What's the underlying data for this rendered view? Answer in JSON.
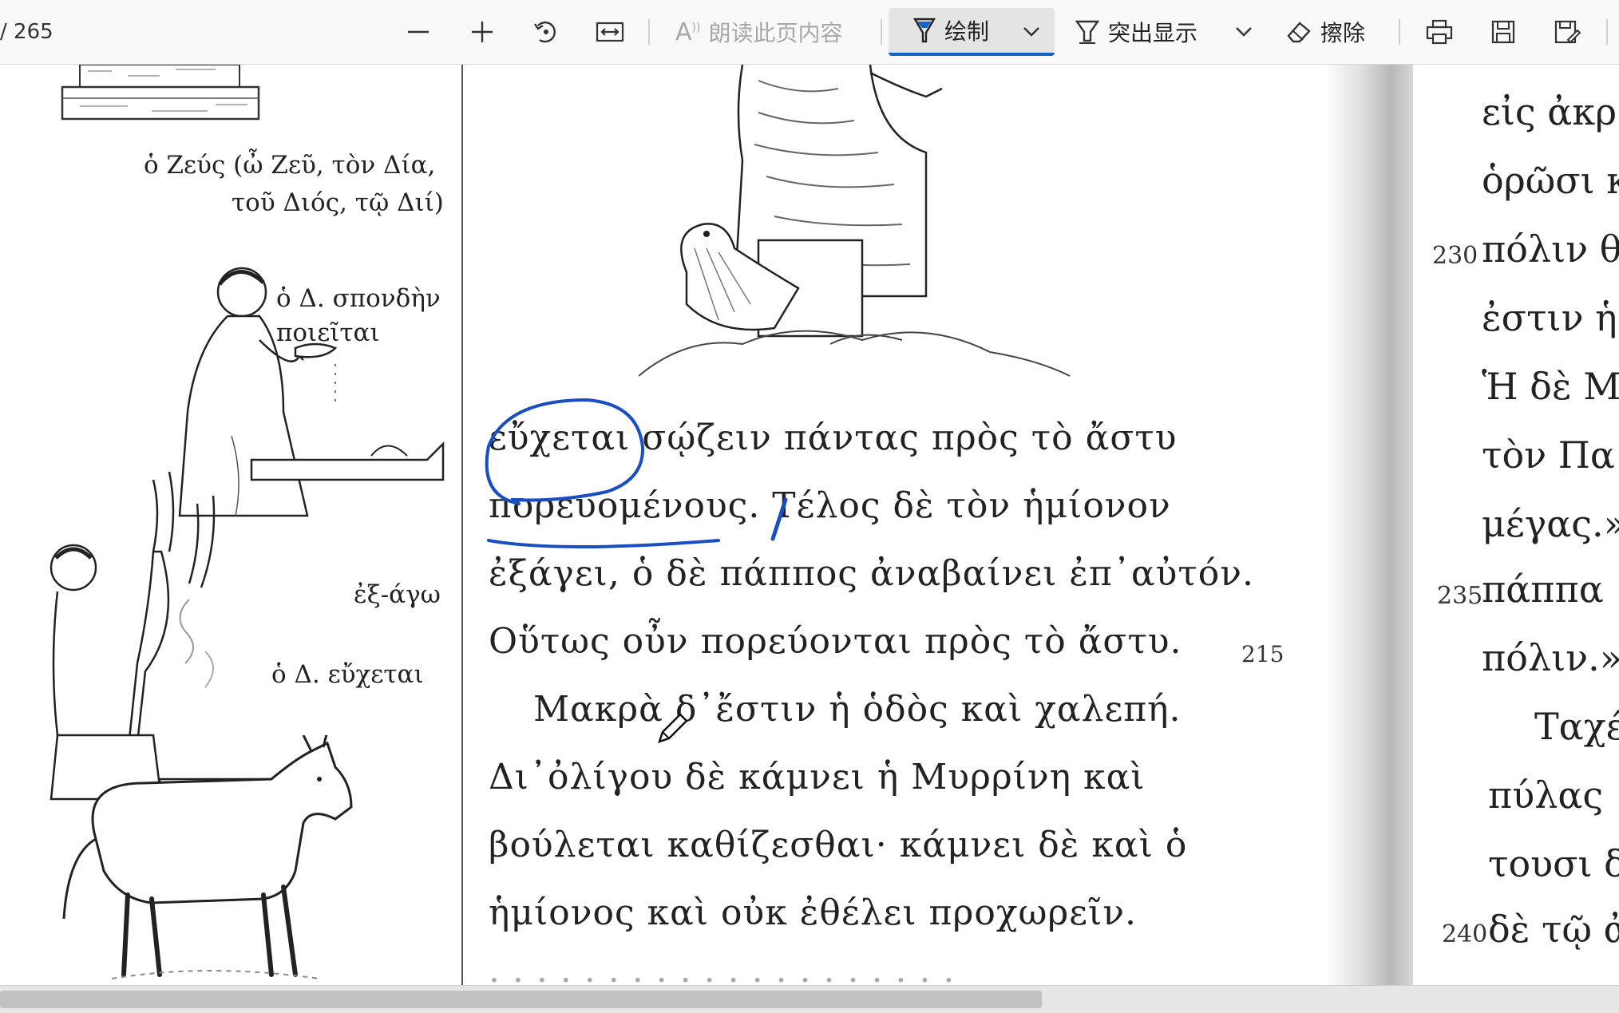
{
  "toolbar": {
    "page_count": "/ 265",
    "read_aloud_label": "朗读此页内容",
    "draw_label": "绘制",
    "highlight_label": "突出显示",
    "erase_label": "擦除",
    "icons": [
      "zoom-out-icon",
      "zoom-in-icon",
      "rotate-icon",
      "fit-width-icon",
      "read-aloud-icon",
      "draw-icon",
      "highlight-icon",
      "eraser-icon",
      "print-icon",
      "save-icon",
      "save-as-icon"
    ],
    "accent_color": "#1463c9"
  },
  "left_page": {
    "captions": {
      "zeus_line1": "ὁ Ζεύς (ὦ Ζεῦ, τὸν Δία,",
      "zeus_line2": "τοῦ Διός, τῷ Διί)",
      "libation_line1": "ὁ Δ. σπονδὴν",
      "libation_line2": "ποιεῖται",
      "exago": "ἐξ-άγω",
      "prays": "ὁ Δ. εὔχεται"
    },
    "text_lines": [
      "εὔχεται σῴζειν πάντας πρὸς τὸ ἄστυ",
      "πορευομένους. Τέλος δὲ τὸν ἡμίονον",
      "ἐξάγει, ὁ δὲ πάππος ἀναβαίνει ἐπ᾽αὐτόν.",
      "Οὕτως οὖν πορεύονται πρὸς τὸ ἄστυ.",
      "Μακρὰ δ᾽ἔστιν ἡ ὁδὸς καὶ χαλεπή.",
      "Δι᾽ὀλίγου δὲ κάμνει ἡ Μυρρίνη καὶ",
      "βούλεται καθίζεσθαι· κάμνει δὲ καὶ ὁ",
      "ἡμίονος καὶ οὐκ ἐθέλει προχωρεῖν."
    ],
    "line_number": "215",
    "ink_color": "#1a4fc4"
  },
  "right_page": {
    "lines": [
      "εἰς ἀκρ",
      "ὁρῶσι κ",
      "πόλιν θε",
      "ἐστιν ἡ",
      "Ἡ δὲ Μ",
      "τὸν Πα",
      "μέγας.»",
      "πάππα",
      "πόλιν.»",
      "Ταχέ",
      "πύλας",
      "τουσι δ",
      "δὲ τῷ ἀ"
    ],
    "line_numbers": [
      "230",
      "235",
      "240"
    ]
  }
}
